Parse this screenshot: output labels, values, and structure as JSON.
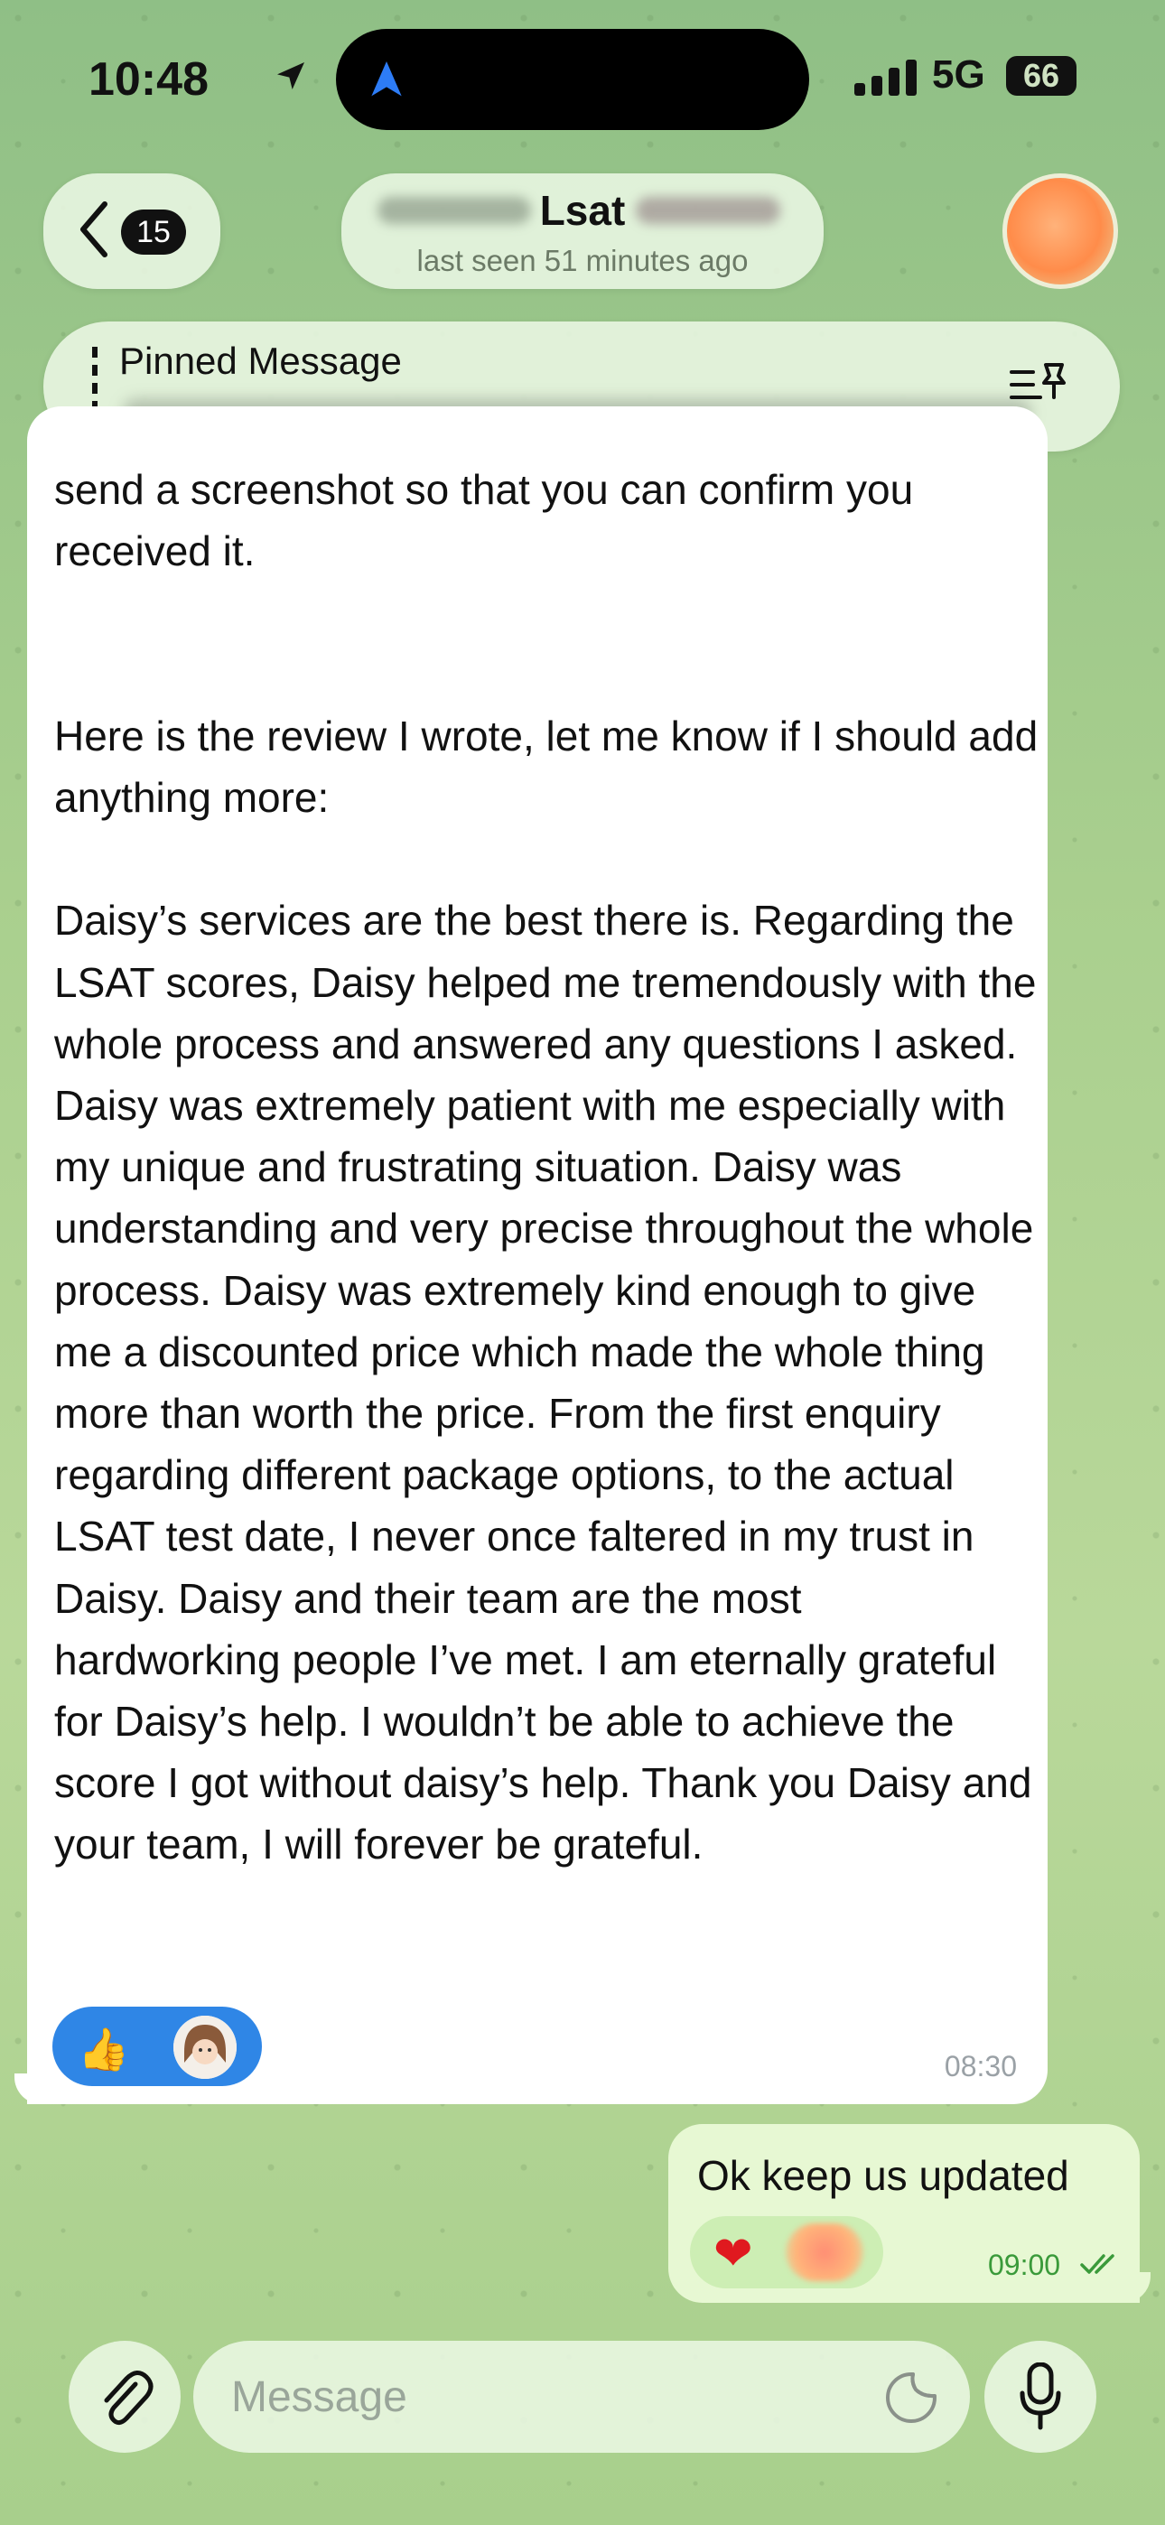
{
  "status_bar": {
    "time": "10:48",
    "network": "5G",
    "battery": "66"
  },
  "header": {
    "back_count": "15",
    "contact_name": "Lsat",
    "last_seen": "last seen 51 minutes ago"
  },
  "pinned": {
    "label": "Pinned Message"
  },
  "messages": {
    "incoming_text": "send a screenshot so that you can confirm you received it.\n\n\nHere is the review I wrote, let me know if I should add anything more:\n\nDaisy’s services are the best there is. Regarding the LSAT scores, Daisy helped me tremendously with the whole process and answered any questions I asked. Daisy was extremely patient with me especially with my unique and frustrating situation. Daisy was understanding and very precise throughout the whole process. Daisy was extremely kind enough to give me a discounted price which made the whole thing more than worth the price. From the first enquiry regarding different package options, to the actual LSAT test date, I never once faltered in my trust in Daisy. Daisy and their team are the most hardworking people I’ve met. I am eternally grateful for Daisy’s help. I wouldn’t be able to achieve the score I got without daisy’s help. Thank you Daisy and your team, I will forever be grateful.",
    "incoming_time": "08:30",
    "incoming_reaction": "👍",
    "outgoing_text": "Ok keep us updated",
    "outgoing_time": "09:00",
    "outgoing_reaction": "❤"
  },
  "composer": {
    "placeholder": "Message"
  },
  "colors": {
    "accent_blue": "#2f86e6",
    "outgoing_bubble": "#e7f8d3",
    "check_green": "#3a9a3a"
  }
}
